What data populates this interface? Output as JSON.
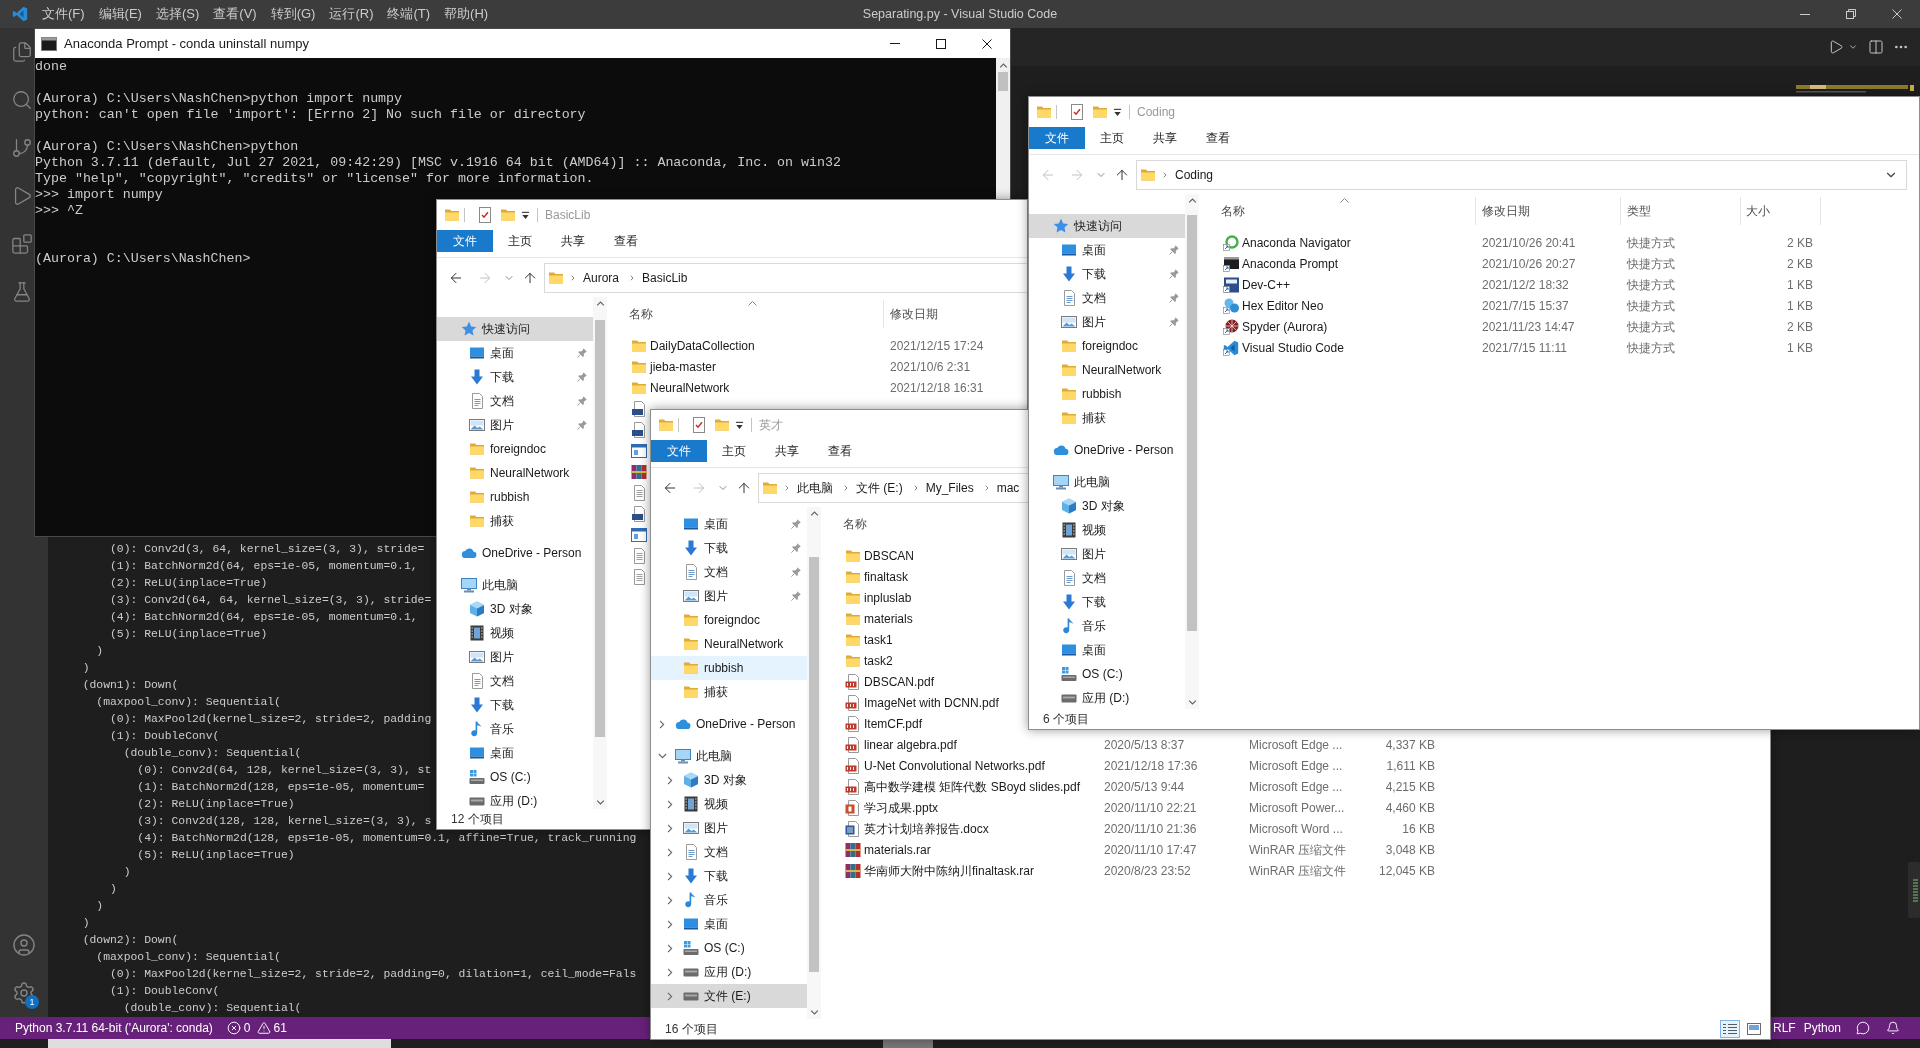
{
  "vscode": {
    "menu": [
      "文件(F)",
      "编辑(E)",
      "选择(S)",
      "查看(V)",
      "转到(G)",
      "运行(R)",
      "终端(T)",
      "帮助(H)"
    ],
    "title": "Separating.py - Visual Studio Code",
    "settings_badge": "1",
    "terminal_lines": [
      "      (0): Conv2d(3, 64, kernel_size=(3, 3), stride=",
      "      (1): BatchNorm2d(64, eps=1e-05, momentum=0.1,",
      "      (2): ReLU(inplace=True)",
      "      (3): Conv2d(64, 64, kernel_size=(3, 3), stride=",
      "      (4): BatchNorm2d(64, eps=1e-05, momentum=0.1,",
      "      (5): ReLU(inplace=True)",
      "    )",
      "  )",
      "  (down1): Down(",
      "    (maxpool_conv): Sequential(",
      "      (0): MaxPool2d(kernel_size=2, stride=2, padding",
      "      (1): DoubleConv(",
      "        (double_conv): Sequential(",
      "          (0): Conv2d(64, 128, kernel_size=(3, 3), st",
      "          (1): BatchNorm2d(128, eps=1e-05, momentum=",
      "          (2): ReLU(inplace=True)",
      "          (3): Conv2d(128, 128, kernel_size=(3, 3), s",
      "          (4): BatchNorm2d(128, eps=1e-05, momentum=0.1, affine=True, track_running",
      "          (5): ReLU(inplace=True)",
      "        )",
      "      )",
      "    )",
      "  )",
      "  (down2): Down(",
      "    (maxpool_conv): Sequential(",
      "      (0): MaxPool2d(kernel_size=2, stride=2, padding=0, dilation=1, ceil_mode=Fals",
      "      (1): DoubleConv(",
      "        (double_conv): Sequential("
    ],
    "status_bar": {
      "interpreter": "Python 3.7.11 64-bit ('Aurora': conda)",
      "errors": "0",
      "warnings": "61",
      "eol": "RLF",
      "language": "Python"
    }
  },
  "prompt_window": {
    "title": "Anaconda Prompt - conda uninstall numpy",
    "lines": [
      {
        "kind": "text",
        "text": "done"
      },
      {
        "kind": "blank"
      },
      {
        "kind": "text",
        "text": "(Aurora) C:\\Users\\NashChen>python import numpy"
      },
      {
        "kind": "text",
        "text": "python: can't open file 'import': [Errno 2] No such file or directory"
      },
      {
        "kind": "blank"
      },
      {
        "kind": "text",
        "text": "(Aurora) C:\\Users\\NashChen>python"
      },
      {
        "kind": "text",
        "text": "Python 3.7.11 (default, Jul 27 2021, 09:42:29) [MSC v.1916 64 bit (AMD64)] :: Anaconda, Inc. on win32"
      },
      {
        "kind": "text",
        "text": "Type \"help\", \"copyright\", \"credits\" or \"license\" for more information."
      },
      {
        "kind": "text",
        "text": ">>> import numpy"
      },
      {
        "kind": "text",
        "text": ">>> ^Z"
      },
      {
        "kind": "blank"
      },
      {
        "kind": "blank"
      },
      {
        "kind": "text",
        "text": "(Aurora) C:\\Users\\NashChen>"
      }
    ]
  },
  "explorer_windows": [
    {
      "title": "BasicLib",
      "ribbon_tabs": [
        {
          "label": "文件",
          "selected": true
        },
        {
          "label": "主页",
          "selected": false
        },
        {
          "label": "共享",
          "selected": false
        },
        {
          "label": "查看",
          "selected": false
        }
      ],
      "back": {
        "disabled": false
      },
      "forward": {
        "disabled": true
      },
      "path": [
        "Aurora",
        "BasicLib"
      ],
      "nav": [
        {
          "label": "快速访问",
          "kind": "star",
          "selected": true,
          "children": [
            {
              "label": "桌面",
              "kind": "desktop",
              "selected": false,
              "pinned": true
            },
            {
              "label": "下载",
              "kind": "downloads",
              "selected": false,
              "pinned": true
            },
            {
              "label": "文档",
              "kind": "documents",
              "selected": false,
              "pinned": true
            },
            {
              "label": "图片",
              "kind": "pictures",
              "selected": false,
              "pinned": true
            },
            {
              "label": "foreigndoc",
              "kind": "folder",
              "selected": false,
              "pinned": false
            },
            {
              "label": "NeuralNetwork",
              "kind": "folder",
              "selected": false,
              "pinned": false
            },
            {
              "label": "rubbish",
              "kind": "folder",
              "selected": false,
              "pinned": false
            },
            {
              "label": "捕获",
              "kind": "folder",
              "selected": false,
              "pinned": false
            }
          ]
        },
        {
          "label": "OneDrive - Person",
          "kind": "cloud",
          "selected": false
        },
        {
          "label": "此电脑",
          "kind": "computer",
          "selected": false,
          "children": [
            {
              "label": "3D 对象",
              "kind": "objects3d",
              "selected": false
            },
            {
              "label": "视频",
              "kind": "videos",
              "selected": false
            },
            {
              "label": "图片",
              "kind": "pictures",
              "selected": false
            },
            {
              "label": "文档",
              "kind": "documents",
              "selected": false
            },
            {
              "label": "下载",
              "kind": "downloads",
              "selected": false
            },
            {
              "label": "音乐",
              "kind": "music",
              "selected": false
            },
            {
              "label": "桌面",
              "kind": "desktop",
              "selected": false
            },
            {
              "label": "OS (C:)",
              "kind": "os-drive",
              "selected": false
            },
            {
              "label": "应用 (D:)",
              "kind": "drive",
              "selected": false
            }
          ]
        }
      ],
      "columns": [
        {
          "label": "名称",
          "sorted": true
        },
        {
          "label": "修改日期",
          "sorted": false
        }
      ],
      "files": [
        {
          "name": "DailyDataCollection",
          "kind": "folder",
          "modified": "2021/12/15 17:24"
        },
        {
          "name": "jieba-master",
          "kind": "folder",
          "modified": "2021/10/6 2:31"
        },
        {
          "name": "NeuralNetwork",
          "kind": "folder",
          "modified": "2021/12/18 16:31"
        },
        {
          "kind": "cpp"
        },
        {
          "kind": "cpp"
        },
        {
          "kind": "exe"
        },
        {
          "kind": "rar"
        },
        {
          "kind": "text"
        },
        {
          "kind": "cpp"
        },
        {
          "kind": "exe"
        },
        {
          "kind": "text"
        },
        {
          "kind": "text"
        }
      ],
      "status": "12 个项目"
    },
    {
      "title": "英才",
      "ribbon_tabs": [
        {
          "label": "文件",
          "selected": true
        },
        {
          "label": "主页",
          "selected": false
        },
        {
          "label": "共享",
          "selected": false
        },
        {
          "label": "查看",
          "selected": false
        }
      ],
      "back": {
        "disabled": false
      },
      "forward": {
        "disabled": true
      },
      "path": [
        "此电脑",
        "文件 (E:)",
        "My_Files",
        "mac"
      ],
      "nav": [
        {
          "children": [
            {
              "label": "桌面",
              "kind": "desktop",
              "selected": false,
              "hovered": false,
              "pinned": true
            },
            {
              "label": "下载",
              "kind": "downloads",
              "selected": false,
              "hovered": false,
              "pinned": true
            },
            {
              "label": "文档",
              "kind": "documents",
              "selected": false,
              "hovered": false,
              "pinned": true
            },
            {
              "label": "图片",
              "kind": "pictures",
              "selected": false,
              "hovered": false,
              "pinned": true
            },
            {
              "label": "foreigndoc",
              "kind": "folder",
              "selected": false,
              "hovered": false,
              "pinned": false
            },
            {
              "label": "NeuralNetwork",
              "kind": "folder",
              "selected": false,
              "hovered": false,
              "pinned": false
            },
            {
              "label": "rubbish",
              "kind": "folder",
              "selected": false,
              "hovered": true,
              "pinned": false
            },
            {
              "label": "捕获",
              "kind": "folder",
              "selected": false,
              "hovered": false,
              "pinned": false
            }
          ]
        },
        {
          "label": "OneDrive - Person",
          "kind": "cloud",
          "selected": false,
          "hovered": false,
          "expanded": false
        },
        {
          "label": "此电脑",
          "kind": "computer",
          "selected": false,
          "hovered": false,
          "expanded": true,
          "children": [
            {
              "label": "3D 对象",
              "kind": "objects3d",
              "selected": false,
              "hovered": false,
              "expanded": false
            },
            {
              "label": "视频",
              "kind": "videos",
              "selected": false,
              "hovered": false,
              "expanded": false
            },
            {
              "label": "图片",
              "kind": "pictures",
              "selected": false,
              "hovered": false,
              "expanded": false
            },
            {
              "label": "文档",
              "kind": "documents",
              "selected": false,
              "hovered": false,
              "expanded": false
            },
            {
              "label": "下载",
              "kind": "downloads",
              "selected": false,
              "hovered": false,
              "expanded": false
            },
            {
              "label": "音乐",
              "kind": "music",
              "selected": false,
              "hovered": false,
              "expanded": false
            },
            {
              "label": "桌面",
              "kind": "desktop",
              "selected": false,
              "hovered": false,
              "expanded": false
            },
            {
              "label": "OS (C:)",
              "kind": "os-drive",
              "selected": false,
              "hovered": false,
              "expanded": false
            },
            {
              "label": "应用 (D:)",
              "kind": "drive",
              "selected": false,
              "hovered": false,
              "expanded": false
            },
            {
              "label": "文件 (E:)",
              "kind": "drive",
              "selected": true,
              "hovered": false,
              "expanded": false
            }
          ]
        }
      ],
      "columns": [
        {
          "label": "名称",
          "sorted": false
        }
      ],
      "files": [
        {
          "name": "DBSCAN",
          "kind": "folder"
        },
        {
          "name": "finaltask",
          "kind": "folder"
        },
        {
          "name": "inpluslab",
          "kind": "folder"
        },
        {
          "name": "materials",
          "kind": "folder"
        },
        {
          "name": "task1",
          "kind": "folder"
        },
        {
          "name": "task2",
          "kind": "folder"
        },
        {
          "name": "DBSCAN.pdf",
          "kind": "pdf"
        },
        {
          "name": "ImageNet with DCNN.pdf",
          "kind": "pdf"
        },
        {
          "name": "ItemCF.pdf",
          "kind": "pdf"
        },
        {
          "name": "linear algebra.pdf",
          "kind": "pdf",
          "modified": "2020/5/13 8:37",
          "type": "Microsoft Edge ...",
          "size": "4,337 KB"
        },
        {
          "name": "U-Net Convolutional Networks.pdf",
          "kind": "pdf",
          "modified": "2021/12/18 17:36",
          "type": "Microsoft Edge ...",
          "size": "1,611 KB"
        },
        {
          "name": "高中数学建模 矩阵代数 SBoyd slides.pdf",
          "kind": "pdf",
          "modified": "2020/5/13 9:44",
          "type": "Microsoft Edge ...",
          "size": "4,215 KB"
        },
        {
          "name": "学习成果.pptx",
          "kind": "pptx",
          "modified": "2020/11/10 22:21",
          "type": "Microsoft Power...",
          "size": "4,460 KB"
        },
        {
          "name": "英才计划培养报告.docx",
          "kind": "docx",
          "modified": "2020/11/10 21:36",
          "type": "Microsoft Word ...",
          "size": "16 KB"
        },
        {
          "name": "materials.rar",
          "kind": "rar",
          "modified": "2020/11/10 17:47",
          "type": "WinRAR 压缩文件",
          "size": "3,048 KB"
        },
        {
          "name": "华南师大附中陈纳川finaltask.rar",
          "kind": "rar",
          "modified": "2020/8/23 23:52",
          "type": "WinRAR 压缩文件",
          "size": "12,045 KB"
        }
      ],
      "status": "16 个项目",
      "view_modes": [
        {
          "kind": "details",
          "selected": true
        },
        {
          "kind": "tiles",
          "selected": false
        }
      ]
    },
    {
      "title": "Coding",
      "ribbon_tabs": [
        {
          "label": "文件",
          "selected": true
        },
        {
          "label": "主页",
          "selected": false
        },
        {
          "label": "共享",
          "selected": false
        },
        {
          "label": "查看",
          "selected": false
        }
      ],
      "back": {
        "disabled": true
      },
      "forward": {
        "disabled": true
      },
      "path": [
        "Coding"
      ],
      "nav": [
        {
          "label": "快速访问",
          "kind": "star",
          "selected": true,
          "children": [
            {
              "label": "桌面",
              "kind": "desktop",
              "selected": false,
              "pinned": true
            },
            {
              "label": "下载",
              "kind": "downloads",
              "selected": false,
              "pinned": true
            },
            {
              "label": "文档",
              "kind": "documents",
              "selected": false,
              "pinned": true
            },
            {
              "label": "图片",
              "kind": "pictures",
              "selected": false,
              "pinned": true
            },
            {
              "label": "foreigndoc",
              "kind": "folder",
              "selected": false,
              "pinned": false
            },
            {
              "label": "NeuralNetwork",
              "kind": "folder",
              "selected": false,
              "pinned": false
            },
            {
              "label": "rubbish",
              "kind": "folder",
              "selected": false,
              "pinned": false
            },
            {
              "label": "捕获",
              "kind": "folder",
              "selected": false,
              "pinned": false
            }
          ]
        },
        {
          "label": "OneDrive - Person",
          "kind": "cloud",
          "selected": false
        },
        {
          "label": "此电脑",
          "kind": "computer",
          "selected": false,
          "children": [
            {
              "label": "3D 对象",
              "kind": "objects3d",
              "selected": false
            },
            {
              "label": "视频",
              "kind": "videos",
              "selected": false
            },
            {
              "label": "图片",
              "kind": "pictures",
              "selected": false
            },
            {
              "label": "文档",
              "kind": "documents",
              "selected": false
            },
            {
              "label": "下载",
              "kind": "downloads",
              "selected": false
            },
            {
              "label": "音乐",
              "kind": "music",
              "selected": false
            },
            {
              "label": "桌面",
              "kind": "desktop",
              "selected": false
            },
            {
              "label": "OS (C:)",
              "kind": "os-drive",
              "selected": false
            },
            {
              "label": "应用 (D:)",
              "kind": "drive",
              "selected": false
            }
          ]
        }
      ],
      "columns": [
        {
          "label": "名称",
          "sorted": true
        },
        {
          "label": "修改日期",
          "sorted": false
        },
        {
          "label": "类型",
          "sorted": false
        },
        {
          "label": "大小",
          "sorted": false
        }
      ],
      "files": [
        {
          "name": "Anaconda Navigator",
          "kind": "navigator",
          "modified": "2021/10/26 20:41",
          "type": "快捷方式",
          "size": "2 KB"
        },
        {
          "name": "Anaconda Prompt",
          "kind": "prompt",
          "modified": "2021/10/26 20:27",
          "type": "快捷方式",
          "size": "2 KB"
        },
        {
          "name": "Dev-C++",
          "kind": "ide",
          "modified": "2021/12/2 18:32",
          "type": "快捷方式",
          "size": "1 KB"
        },
        {
          "name": "Hex Editor Neo",
          "kind": "hex-editor",
          "modified": "2021/7/15 15:37",
          "type": "快捷方式",
          "size": "1 KB"
        },
        {
          "name": "Spyder (Aurora)",
          "kind": "spyder",
          "modified": "2021/11/23 14:47",
          "type": "快捷方式",
          "size": "2 KB"
        },
        {
          "name": "Visual Studio Code",
          "kind": "code-editor",
          "modified": "2021/7/15 11:11",
          "type": "快捷方式",
          "size": "1 KB"
        }
      ],
      "status": "6 个项目"
    }
  ]
}
